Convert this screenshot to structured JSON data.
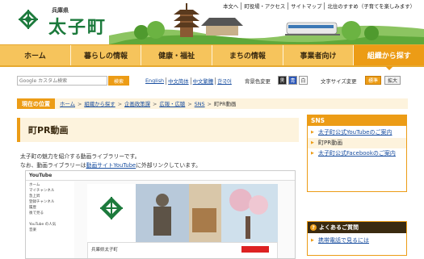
{
  "header": {
    "prefecture": "兵庫県",
    "town_name": "太子町",
    "top_links": [
      "本文へ",
      "町役場・アクセス",
      "サイトマップ",
      "北住のすすめ（子育てを楽しみます）"
    ]
  },
  "nav": {
    "items": [
      "ホーム",
      "暮らしの情報",
      "健康・福祉",
      "まちの情報",
      "事業者向け",
      "組織から探す"
    ],
    "active_index": 5
  },
  "toolbar": {
    "search_placeholder": "Google カスタム検索",
    "search_button": "検索",
    "languages": [
      "English",
      "中文简体",
      "中文繁體",
      "한국어"
    ],
    "bgcolor_label": "背景色変更",
    "bgcolor_buttons": [
      "黒",
      "青",
      "白"
    ],
    "fontsize_label": "文字サイズ変更",
    "fontsize_standard": "標準",
    "fontsize_large": "拡大"
  },
  "breadcrumb": {
    "label": "現在の位置",
    "items": [
      "ホーム",
      "組織から探す",
      "企画政策課",
      "広報・広聴",
      "SNS",
      "町PR動画"
    ]
  },
  "main": {
    "title": "町PR動画",
    "intro_line1": "太子町の魅力を紹介する動画ライブラリーです。",
    "intro_line2_prefix": "なお、動画ライブラリーは",
    "intro_line2_link": "動画サイトYouTube",
    "intro_line2_suffix": "に外部リンクしています。",
    "youtube": {
      "logo": "YouTube",
      "sidebar_items": [
        "ホーム",
        "マイチャンネル",
        "急上昇",
        "登録チャンネル",
        "履歴",
        "後で見る",
        "",
        "YouTube の人気",
        "音楽"
      ],
      "channel_name": "兵庫県太子町"
    }
  },
  "side": {
    "sns_title": "SNS",
    "sns_links": [
      "太子町公式YouTubeのご案内",
      "町PR動画",
      "太子町公式Facebookのご案内"
    ],
    "sns_current_index": 1,
    "faq_title": "よくあるご質問",
    "faq_links": [
      "携帯電話で見るには"
    ]
  },
  "colors": {
    "accent": "#ec9c16",
    "nav_bg": "#f6c45c",
    "brand_green": "#1c7a3c",
    "link": "#1a4fa0"
  }
}
